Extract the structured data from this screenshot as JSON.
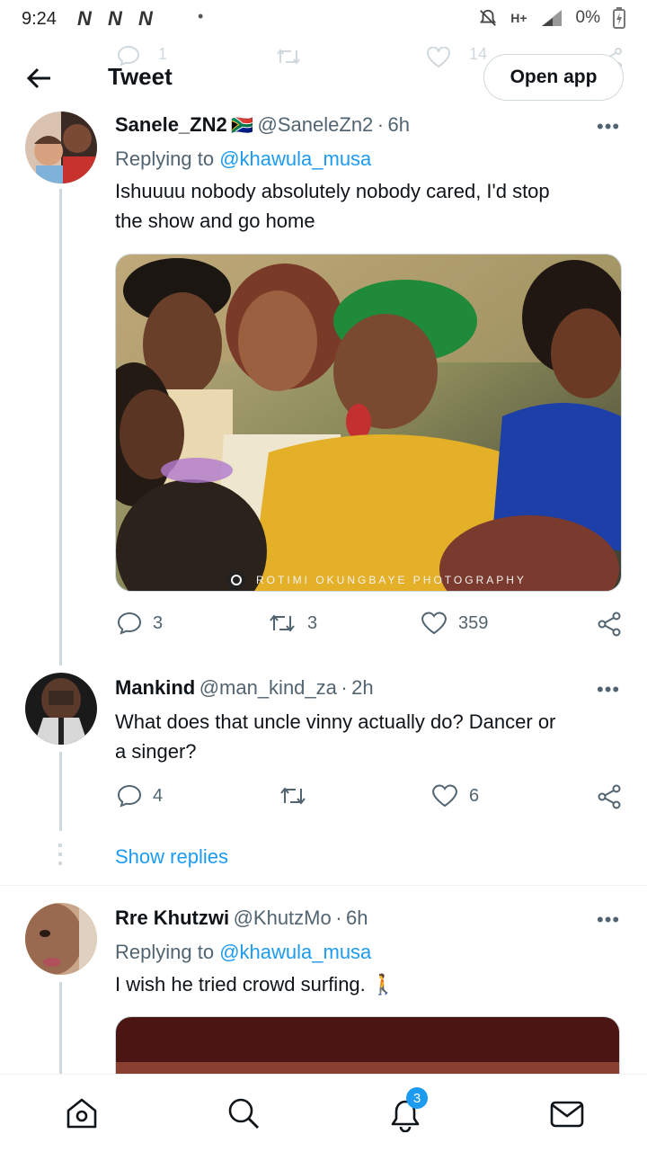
{
  "status_bar": {
    "time": "9:24",
    "network_marks": "N N N",
    "dot": "•",
    "signal": "H+",
    "battery": "0%"
  },
  "header": {
    "title": "Tweet",
    "open_app": "Open app",
    "ghost_reply_count": "1",
    "ghost_like_count": "14"
  },
  "tweets": [
    {
      "name": "Sanele_ZN2",
      "flag": "🇿🇦",
      "handle": "@SaneleZn2",
      "time": "6h",
      "replying_prefix": "Replying to",
      "replying_to": "@khawula_musa",
      "text_line1": "Ishuuuu nobody absolutely nobody cared, I'd stop",
      "text_line2": "the show and go home",
      "media_watermark": "ROTIMI OKUNGBAYE PHOTOGRAPHY",
      "replies": "3",
      "retweets": "3",
      "likes": "359"
    },
    {
      "name": "Mankind",
      "handle": "@man_kind_za",
      "time": "2h",
      "text_line1": "What does that uncle vinny actually do? Dancer or",
      "text_line2": "a singer?",
      "replies": "4",
      "retweets": "",
      "likes": "6"
    },
    {
      "name": "Rre Khutzwi",
      "handle": "@KhutzMo",
      "time": "6h",
      "replying_prefix": "Replying to",
      "replying_to": "@khawula_musa",
      "text_line1": "I wish he tried crowd surfing. 🚶"
    }
  ],
  "show_replies": "Show replies",
  "more": "•••",
  "separator": "·",
  "bottom_nav": {
    "notifications_badge": "3"
  },
  "colors": {
    "accent": "#1d9bf0",
    "text": "#0f1419",
    "muted": "#536471"
  }
}
